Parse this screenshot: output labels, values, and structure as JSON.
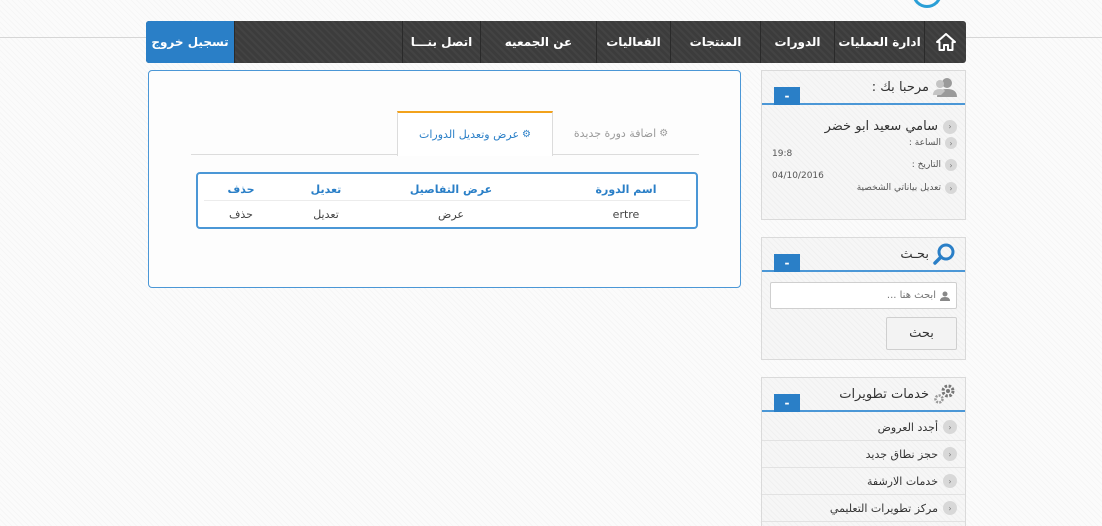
{
  "nav": {
    "items": [
      {
        "label": "ادارة العمليات"
      },
      {
        "label": "الدورات"
      },
      {
        "label": "المنتجات"
      },
      {
        "label": "الفعاليات"
      },
      {
        "label": "عن الجمعيه"
      },
      {
        "label": "اتصل بنـــا"
      }
    ],
    "logout": "تسجيل خروج"
  },
  "main": {
    "tabs": [
      {
        "label": "اضافة دورة جديدة",
        "icon": "⚙"
      },
      {
        "label": "عرض وتعديل الدورات",
        "icon": "⚙"
      }
    ],
    "table": {
      "headers": [
        "اسم الدورة",
        "عرض التفاصيل",
        "تعديل",
        "حذف"
      ],
      "rows": [
        [
          "ertre",
          "عرض",
          "تعديل",
          "حذف"
        ]
      ]
    }
  },
  "welcome": {
    "title": "مرحبا بك :",
    "collapse": "-",
    "user_name": "سامي سعيد ابو خضر",
    "time_label": "الساعة :",
    "time_value": "19:8",
    "date_label": "التاريخ :",
    "date_value": "04/10/2016",
    "edit_label": "تعديل بياناتي الشخصية"
  },
  "search": {
    "title": "بحـث",
    "collapse": "-",
    "placeholder": "ابحث هنا ...",
    "button": "بحث"
  },
  "services": {
    "title": "خدمات تطويرات",
    "collapse": "-",
    "items": [
      {
        "label": "أجدد العروض"
      },
      {
        "label": "حجز نطاق جديد"
      },
      {
        "label": "خدمات الارشفة"
      },
      {
        "label": "مركز تطويرات التعليمي"
      }
    ]
  },
  "colors": {
    "accent": "#2a7fc7",
    "nav_bg": "#3c3c3c",
    "tab_highlight": "#f2a21c"
  }
}
